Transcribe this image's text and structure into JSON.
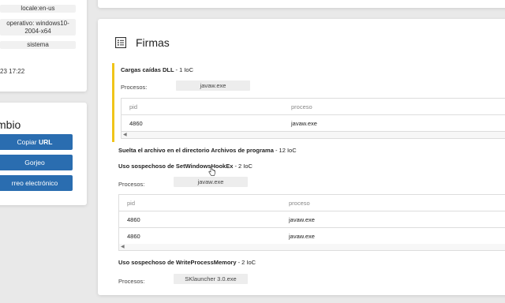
{
  "info": {
    "pills": [
      "locale:en-us",
      "operativo: windows10-2004-x64",
      "sistema"
    ],
    "timestamp": "23 17:22"
  },
  "share": {
    "title": "mbio",
    "buttons": [
      {
        "label_pre": "Copiar ",
        "label_bold": "URL"
      },
      {
        "label_pre": "Gorjeo",
        "label_bold": ""
      },
      {
        "label_pre": "rreo electrónico",
        "label_bold": ""
      }
    ],
    "accent": "#2a6db0"
  },
  "main": {
    "title": "Firmas",
    "icon": "list-icon",
    "highlight_color": "#f0c419",
    "signatures": [
      {
        "name": "Cargas caídas DLL",
        "count": "- 1 IoC",
        "process_label": "Procesos:",
        "process": "javaw.exe",
        "columns": [
          "pid",
          "proceso"
        ],
        "rows": [
          [
            "4860",
            "javaw.exe"
          ]
        ]
      },
      {
        "name": "Suelta el archivo en el directorio Archivos de programa",
        "count": "- 12 IoC"
      },
      {
        "name": "Uso sospechoso de SetWindowsHookEx",
        "count": "- 2 IoC",
        "process_label": "Procesos:",
        "process": "javaw.exe",
        "columns": [
          "pid",
          "proceso"
        ],
        "rows": [
          [
            "4860",
            "javaw.exe"
          ],
          [
            "4860",
            "javaw.exe"
          ]
        ]
      },
      {
        "name": "Uso sospechoso de WriteProcessMemory",
        "count": "- 2 IoC",
        "process_label": "Procesos:",
        "process": "SKlauncher 3.0.exe"
      }
    ]
  }
}
